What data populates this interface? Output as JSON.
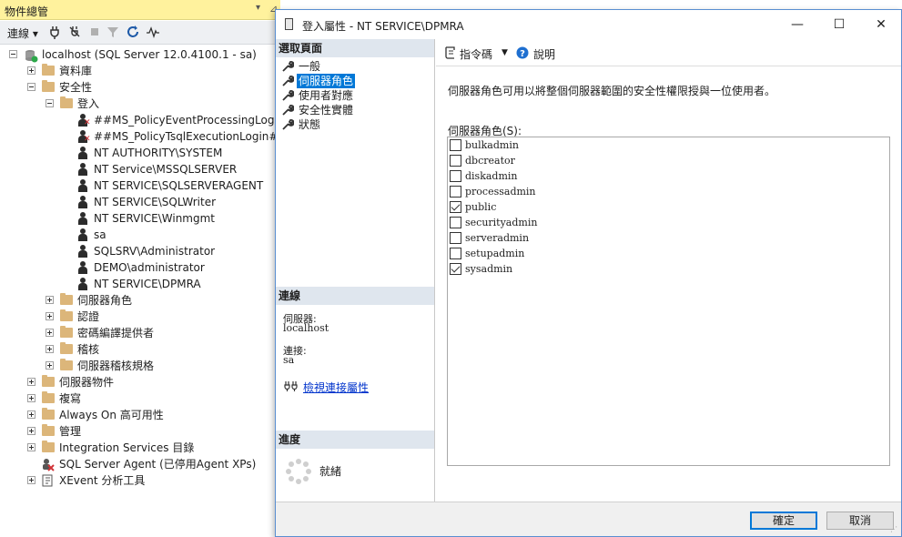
{
  "object_explorer": {
    "title": "物件總管",
    "toolbar": {
      "connect_label": "連線"
    },
    "tree": {
      "server": "localhost (SQL Server 12.0.4100.1 - sa)",
      "databases": "資料庫",
      "security": "安全性",
      "logins": "登入",
      "login_items": [
        "##MS_PolicyEventProcessingLogin##",
        "##MS_PolicyTsqlExecutionLogin##",
        "NT AUTHORITY\\SYSTEM",
        "NT Service\\MSSQLSERVER",
        "NT SERVICE\\SQLSERVERAGENT",
        "NT SERVICE\\SQLWriter",
        "NT SERVICE\\Winmgmt",
        "sa",
        "SQLSRV\\Administrator",
        "DEMO\\administrator",
        "NT SERVICE\\DPMRA"
      ],
      "security_children": [
        "伺服器角色",
        "認證",
        "密碼編譯提供者",
        "稽核",
        "伺服器稽核規格"
      ],
      "top_children": [
        "伺服器物件",
        "複寫",
        "Always On 高可用性",
        "管理",
        "Integration Services 目錄"
      ],
      "agent": "SQL Server Agent (已停用Agent XPs)",
      "xevent": "XEvent 分析工具"
    }
  },
  "dialog": {
    "title": "登入屬性 - NT SERVICE\\DPMRA",
    "select_page_header": "選取頁面",
    "pages": [
      "一般",
      "伺服器角色",
      "使用者對應",
      "安全性實體",
      "狀態"
    ],
    "selected_page": "伺服器角色",
    "connection_header": "連線",
    "server_label": "伺服器:",
    "server_value": "localhost",
    "connection_label": "連接:",
    "connection_value": "sa",
    "view_connection_link": "檢視連接屬性",
    "progress_header": "進度",
    "progress_status": "就緒",
    "toolbar": {
      "script_label": "指令碼",
      "help_label": "說明"
    },
    "description": "伺服器角色可用以將整個伺服器範圍的安全性權限授與一位使用者。",
    "roles_label": "伺服器角色(S):",
    "roles": [
      {
        "name": "bulkadmin",
        "checked": false
      },
      {
        "name": "dbcreator",
        "checked": false
      },
      {
        "name": "diskadmin",
        "checked": false
      },
      {
        "name": "processadmin",
        "checked": false
      },
      {
        "name": "public",
        "checked": true
      },
      {
        "name": "securityadmin",
        "checked": false
      },
      {
        "name": "serveradmin",
        "checked": false
      },
      {
        "name": "setupadmin",
        "checked": false
      },
      {
        "name": "sysadmin",
        "checked": true
      }
    ],
    "ok_label": "確定",
    "cancel_label": "取消"
  }
}
